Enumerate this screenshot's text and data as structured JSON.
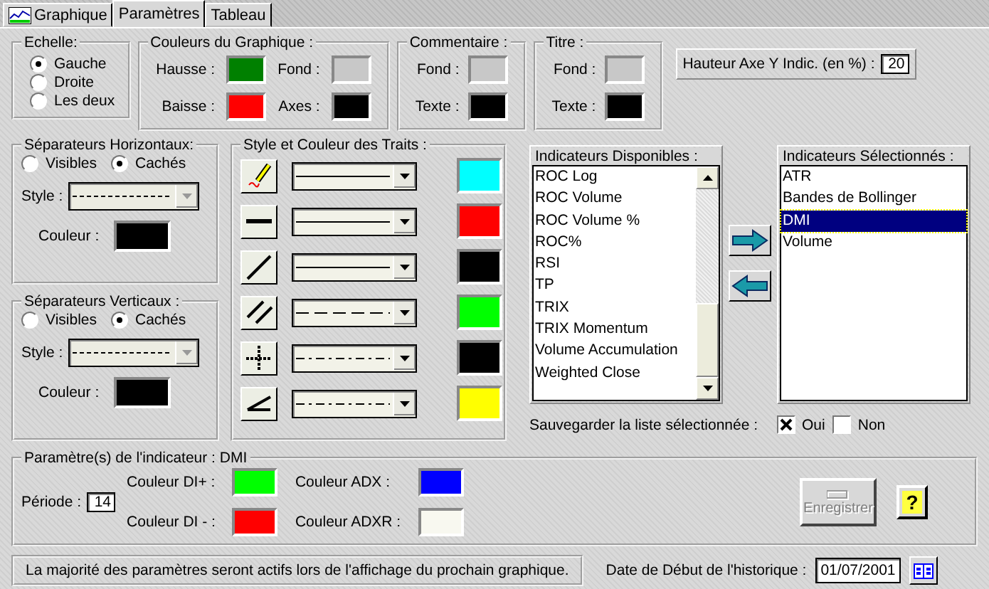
{
  "tabs": [
    {
      "label": "Graphique",
      "kind": "chart",
      "selected": false
    },
    {
      "label": "Paramètres",
      "kind": "plain",
      "selected": true
    },
    {
      "label": "Tableau",
      "kind": "plain",
      "selected": false
    }
  ],
  "echelle": {
    "title": "Echelle:",
    "options": [
      {
        "label": "Gauche",
        "selected": true
      },
      {
        "label": "Droite",
        "selected": false
      },
      {
        "label": "Les deux",
        "selected": false
      }
    ]
  },
  "couleurs_graphique": {
    "title": "Couleurs du Graphique :",
    "fields": [
      {
        "label": "Hausse :",
        "color": "#008000"
      },
      {
        "label": "Fond :",
        "color": "#c8c8c8"
      },
      {
        "label": "Baisse :",
        "color": "#ff0000"
      },
      {
        "label": "Axes :",
        "color": "#000000"
      }
    ]
  },
  "commentaire": {
    "title": "Commentaire :",
    "fields": [
      {
        "label": "Fond :",
        "color": "#c8c8c8"
      },
      {
        "label": "Texte :",
        "color": "#000000"
      }
    ]
  },
  "titre": {
    "title": "Titre :",
    "fields": [
      {
        "label": "Fond :",
        "color": "#c8c8c8"
      },
      {
        "label": "Texte :",
        "color": "#000000"
      }
    ]
  },
  "hauteur": {
    "label": "Hauteur Axe Y Indic. (en %) :",
    "value": "20"
  },
  "separateurs": [
    {
      "title": "Séparateurs Horizontaux:",
      "options": [
        {
          "label": "Visibles",
          "selected": false
        },
        {
          "label": "Cachés",
          "selected": true
        }
      ],
      "style_label": "Style :",
      "line": {
        "kind": "dotted"
      },
      "disabled": true,
      "color_label": "Couleur :",
      "color": "#000000"
    },
    {
      "title": "Séparateurs Verticaux :",
      "options": [
        {
          "label": "Visibles",
          "selected": false
        },
        {
          "label": "Cachés",
          "selected": true
        }
      ],
      "style_label": "Style :",
      "line": {
        "kind": "dotted"
      },
      "disabled": true,
      "color_label": "Couleur :",
      "color": "#000000"
    }
  ],
  "traits": {
    "title": "Style et Couleur des Traits :",
    "rows": [
      {
        "kind": "pen",
        "line": {
          "kind": "solid"
        },
        "color": "#00ffff"
      },
      {
        "kind": "horizontal",
        "line": {
          "kind": "solid"
        },
        "color": "#ff0000"
      },
      {
        "kind": "diagonal",
        "line": {
          "kind": "solid"
        },
        "color": "#000000"
      },
      {
        "kind": "parallel",
        "line": {
          "kind": "dashed"
        },
        "color": "#00ff00"
      },
      {
        "kind": "cross",
        "line": {
          "kind": "dashdot"
        },
        "color": "#000000"
      },
      {
        "kind": "angle",
        "line": {
          "kind": "dashdot"
        },
        "color": "#ffff00"
      }
    ]
  },
  "disponibles": {
    "title": "Indicateurs Disponibles :",
    "items": [
      "ROC Log",
      "ROC Volume",
      "ROC Volume %",
      "ROC%",
      "RSI",
      "TP",
      "TRIX",
      "TRIX Momentum",
      "Volume Accumulation",
      "Weighted Close"
    ]
  },
  "selectionnes": {
    "title": "Indicateurs Sélectionnés :",
    "items": [
      {
        "label": "ATR",
        "selected": false
      },
      {
        "label": "Bandes de Bollinger",
        "selected": false
      },
      {
        "label": "DMI",
        "selected": true
      },
      {
        "label": "Volume",
        "selected": false
      }
    ]
  },
  "sauvegarder": {
    "label": "Sauvegarder la liste sélectionnée :",
    "options": [
      {
        "label": "Oui",
        "checked": true
      },
      {
        "label": "Non",
        "checked": false
      }
    ]
  },
  "parametres": {
    "title": "Paramètre(s) de l'indicateur : DMI",
    "periode_label": "Période :",
    "periode": "14",
    "colors": [
      {
        "label": "Couleur DI+ :",
        "color": "#00ff00"
      },
      {
        "label": "Couleur ADX :",
        "color": "#0000ff"
      },
      {
        "label": "Couleur DI - :",
        "color": "#ff0000"
      },
      {
        "label": "Couleur ADXR :",
        "color": "#f8f8f0"
      }
    ],
    "save_button": {
      "label": "Enregistrer",
      "disabled": true
    },
    "help_button": "?"
  },
  "footer": {
    "message": "La majorité des paramètres seront actifs lors de l'affichage du prochain graphique.",
    "date_label": "Date de Début de l'historique :",
    "date": "01/07/2001"
  }
}
